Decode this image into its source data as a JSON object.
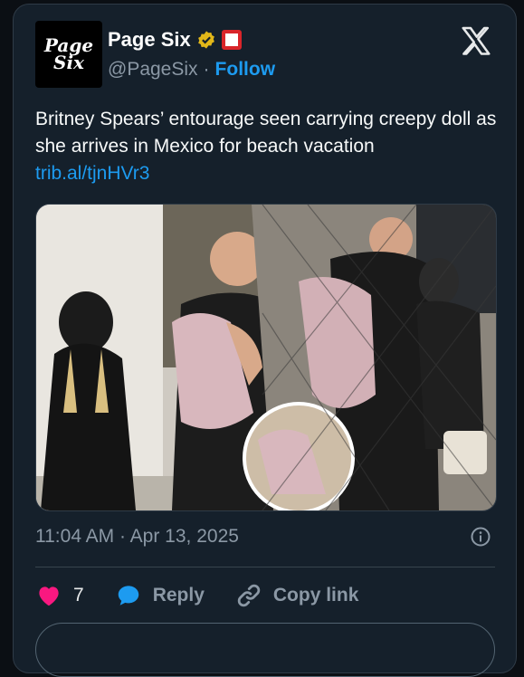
{
  "account": {
    "avatar_line1": "Page",
    "avatar_line2": "Six",
    "name": "Page Six",
    "handle": "@PageSix",
    "separator": "·",
    "follow_label": "Follow"
  },
  "tweet": {
    "text": "Britney Spears’ entourage seen carrying creepy doll as she arrives in Mexico for beach vacation",
    "link": "trib.al/tjnHVr3",
    "timestamp": "11:04 AM · Apr 13, 2025"
  },
  "actions": {
    "like_count": "7",
    "reply_label": "Reply",
    "copy_link_label": "Copy link"
  },
  "colors": {
    "background": "#15202b",
    "accent": "#1d9bf0",
    "like": "#f91880",
    "verified": "#e2b719"
  }
}
